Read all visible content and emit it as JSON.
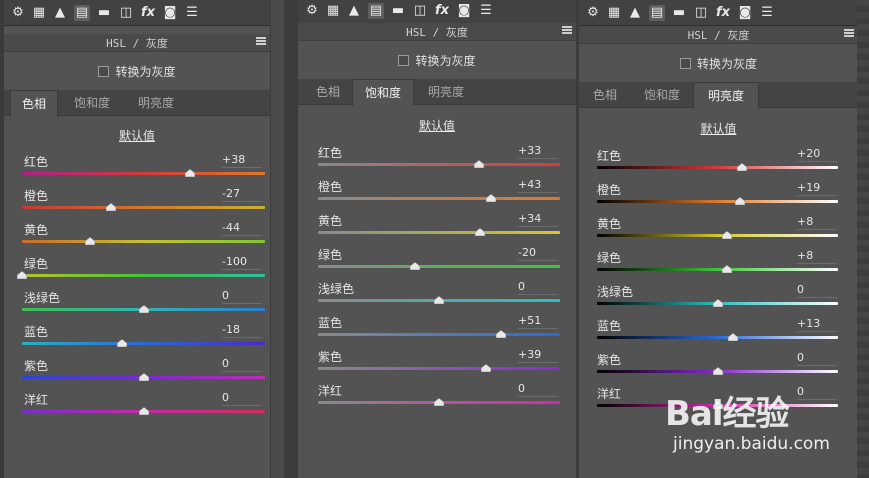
{
  "panels": [
    {
      "title": "HSL / 灰度",
      "convert_label": "转换为灰度",
      "tabs": [
        "色相",
        "饱和度",
        "明亮度"
      ],
      "active_tab": 0,
      "default_label": "默认值",
      "sliders": [
        {
          "label": "红色",
          "value": "+38"
        },
        {
          "label": "橙色",
          "value": "-27"
        },
        {
          "label": "黄色",
          "value": "-44"
        },
        {
          "label": "绿色",
          "value": "-100"
        },
        {
          "label": "浅绿色",
          "value": "0"
        },
        {
          "label": "蓝色",
          "value": "-18"
        },
        {
          "label": "紫色",
          "value": "0"
        },
        {
          "label": "洋红",
          "value": "0"
        }
      ]
    },
    {
      "title": "HSL / 灰度",
      "convert_label": "转换为灰度",
      "tabs": [
        "色相",
        "饱和度",
        "明亮度"
      ],
      "active_tab": 1,
      "default_label": "默认值",
      "sliders": [
        {
          "label": "红色",
          "value": "+33"
        },
        {
          "label": "橙色",
          "value": "+43"
        },
        {
          "label": "黄色",
          "value": "+34"
        },
        {
          "label": "绿色",
          "value": "-20"
        },
        {
          "label": "浅绿色",
          "value": "0"
        },
        {
          "label": "蓝色",
          "value": "+51"
        },
        {
          "label": "紫色",
          "value": "+39"
        },
        {
          "label": "洋红",
          "value": "0"
        }
      ]
    },
    {
      "title": "HSL / 灰度",
      "convert_label": "转换为灰度",
      "tabs": [
        "色相",
        "饱和度",
        "明亮度"
      ],
      "active_tab": 2,
      "default_label": "默认值",
      "sliders": [
        {
          "label": "红色",
          "value": "+20"
        },
        {
          "label": "橙色",
          "value": "+19"
        },
        {
          "label": "黄色",
          "value": "+8"
        },
        {
          "label": "绿色",
          "value": "+8"
        },
        {
          "label": "浅绿色",
          "value": "0"
        },
        {
          "label": "蓝色",
          "value": "+13"
        },
        {
          "label": "紫色",
          "value": "0"
        },
        {
          "label": "洋红",
          "value": "0"
        }
      ]
    }
  ],
  "toolbar_icons": [
    "aperture-icon",
    "grid-icon",
    "mountain-icon",
    "hsl-panel-icon",
    "split-toning-icon",
    "lens-icon",
    "fx-icon",
    "camera-icon",
    "sliders-icon"
  ],
  "watermark": {
    "logo": "Bai经验",
    "url": "jingyan.baidu.com"
  },
  "colors": {
    "panel_bg": "#535353",
    "toolbar_bg": "#424242",
    "text": "#e6e6e6"
  }
}
